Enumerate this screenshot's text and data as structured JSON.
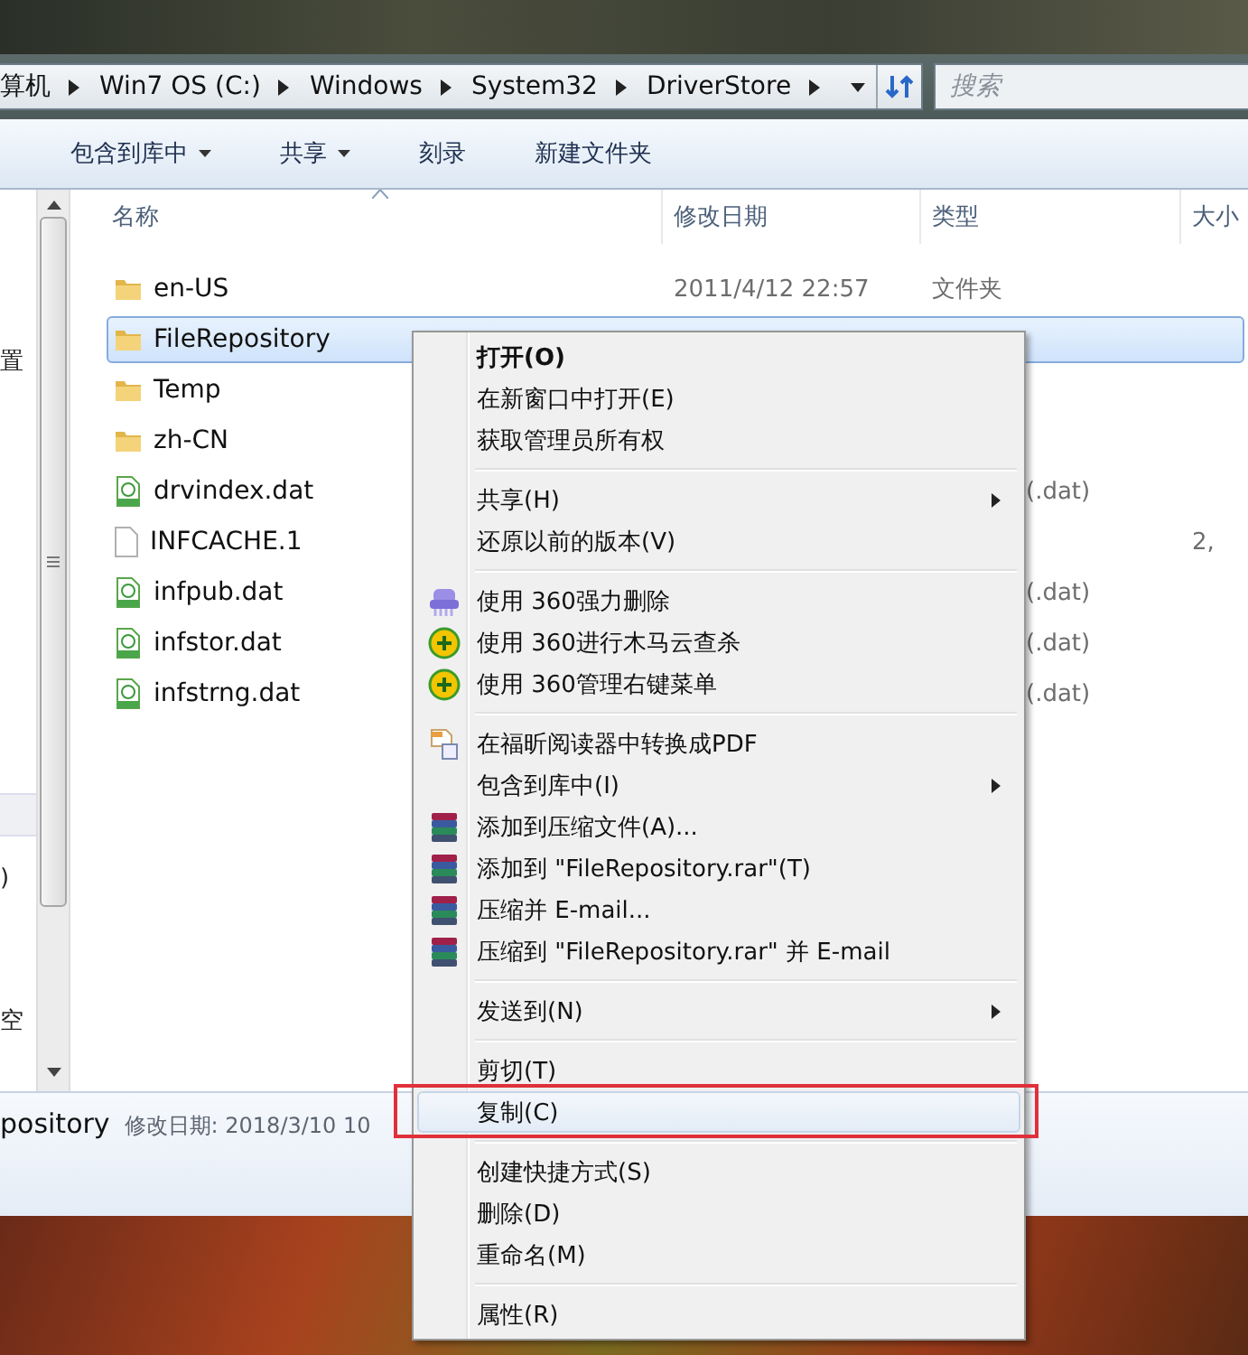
{
  "address_bar": {
    "segments": [
      "算机",
      "Win7 OS (C:)",
      "Windows",
      "System32",
      "DriverStore"
    ]
  },
  "search": {
    "placeholder": "搜索"
  },
  "toolbar": [
    {
      "label": "包含到库中",
      "dropdown": true
    },
    {
      "label": "共享",
      "dropdown": true
    },
    {
      "label": "刻录",
      "dropdown": false
    },
    {
      "label": "新建文件夹",
      "dropdown": false
    }
  ],
  "nav_pane": {
    "items": [
      "置",
      ")",
      "空"
    ]
  },
  "columns": [
    "名称",
    "修改日期",
    "类型",
    "大小"
  ],
  "files": [
    {
      "name": "en-US",
      "kind": "folder",
      "selected": false,
      "modified": "2011/4/12 22:57",
      "type": "文件夹"
    },
    {
      "name": "FileRepository",
      "kind": "folder",
      "selected": true
    },
    {
      "name": "Temp",
      "kind": "folder",
      "selected": false
    },
    {
      "name": "zh-CN",
      "kind": "folder",
      "selected": false
    },
    {
      "name": "drvindex.dat",
      "kind": "dat",
      "selected": false,
      "type": "(.dat)"
    },
    {
      "name": "INFCACHE.1",
      "kind": "file",
      "selected": false,
      "size": "2,"
    },
    {
      "name": "infpub.dat",
      "kind": "dat",
      "selected": false,
      "type": "(.dat)"
    },
    {
      "name": "infstor.dat",
      "kind": "dat",
      "selected": false,
      "type": "(.dat)"
    },
    {
      "name": "infstrng.dat",
      "kind": "dat",
      "selected": false,
      "type": "(.dat)"
    }
  ],
  "status_bar": {
    "name": "pository",
    "detail": "修改日期: 2018/3/10 10"
  },
  "context_menu": {
    "items": [
      {
        "kind": "item",
        "label": "打开(O)",
        "default": true,
        "selected": false
      },
      {
        "kind": "item",
        "label": "在新窗口中打开(E)",
        "selected": false
      },
      {
        "kind": "item",
        "label": "获取管理员所有权",
        "selected": false
      },
      {
        "kind": "separator"
      },
      {
        "kind": "item",
        "label": "共享(H)",
        "submenu": true,
        "selected": false
      },
      {
        "kind": "item",
        "label": "还原以前的版本(V)",
        "selected": false
      },
      {
        "kind": "separator"
      },
      {
        "kind": "shredder",
        "label": "使用 360强力删除",
        "selected": false
      },
      {
        "kind": "shield",
        "label": "使用 360进行木马云查杀",
        "selected": false
      },
      {
        "kind": "shield",
        "label": "使用 360管理右键菜单",
        "selected": false
      },
      {
        "kind": "separator"
      },
      {
        "kind": "pdf",
        "label": "在福昕阅读器中转换成PDF",
        "selected": false
      },
      {
        "kind": "item",
        "label": "包含到库中(I)",
        "submenu": true,
        "selected": false
      },
      {
        "kind": "archive",
        "label": "添加到压缩文件(A)...",
        "selected": false
      },
      {
        "kind": "archive",
        "label": "添加到 \"FileRepository.rar\"(T)",
        "selected": false
      },
      {
        "kind": "archive",
        "label": "压缩并 E-mail...",
        "selected": false
      },
      {
        "kind": "archive",
        "label": "压缩到 \"FileRepository.rar\" 并 E-mail",
        "selected": false
      },
      {
        "kind": "separator"
      },
      {
        "kind": "item",
        "label": "发送到(N)",
        "submenu": true,
        "selected": false
      },
      {
        "kind": "separator"
      },
      {
        "kind": "item",
        "label": "剪切(T)",
        "selected": false
      },
      {
        "kind": "item",
        "label": "复制(C)",
        "selected": true,
        "marked": true
      },
      {
        "kind": "separator"
      },
      {
        "kind": "item",
        "label": "创建快捷方式(S)",
        "selected": false
      },
      {
        "kind": "item",
        "label": "删除(D)",
        "selected": false
      },
      {
        "kind": "item",
        "label": "重命名(M)",
        "selected": false
      },
      {
        "kind": "separator"
      },
      {
        "kind": "item",
        "label": "属性(R)",
        "selected": false
      }
    ]
  }
}
